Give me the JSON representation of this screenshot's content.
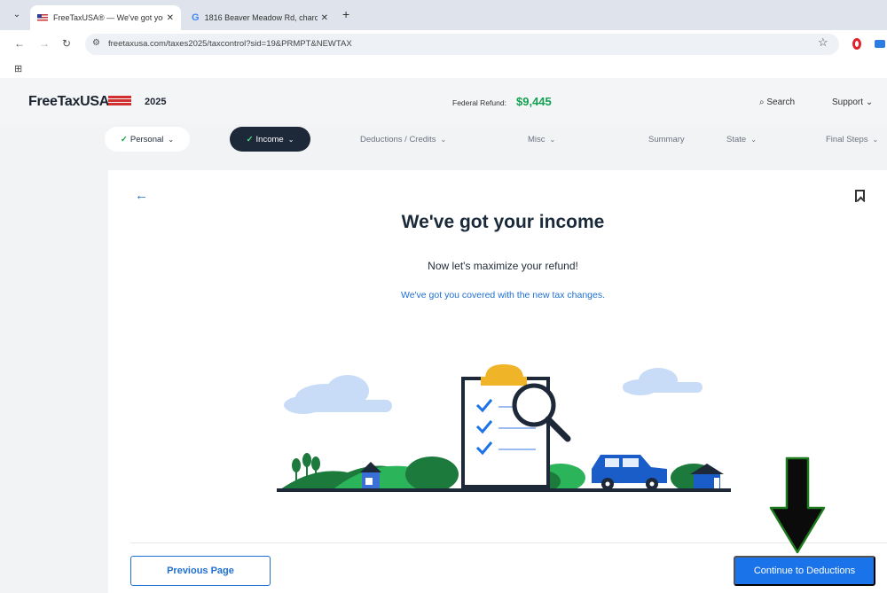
{
  "browser": {
    "tabs": [
      {
        "title": "FreeTaxUSA® — We've got you",
        "active": true
      },
      {
        "title": "1816 Beaver Meadow Rd, charc",
        "active": false
      }
    ],
    "url": "freetaxusa.com/taxes2025/taxcontrol?sid=19&PRMPT&NEWTAX"
  },
  "header": {
    "logo": "FreeTaxUSA",
    "year": "2025",
    "refund_label": "Federal Refund:",
    "refund_value": "$9,445",
    "search_label": "Search",
    "support_label": "Support"
  },
  "steps": [
    {
      "label": "Personal",
      "status": "done"
    },
    {
      "label": "Income",
      "status": "current"
    },
    {
      "label": "Deductions / Credits",
      "status": "todo"
    },
    {
      "label": "Misc",
      "status": "todo"
    },
    {
      "label": "Summary",
      "status": "todo"
    },
    {
      "label": "State",
      "status": "todo"
    },
    {
      "label": "Final Steps",
      "status": "todo"
    }
  ],
  "main": {
    "title": "We've got your income",
    "subtitle": "Now let's maximize your refund!",
    "link_text": "We've got you covered with the new tax changes.",
    "prev_button": "Previous Page",
    "next_button": "Continue to Deductions"
  },
  "colors": {
    "accent": "#1a73e8",
    "refund_green": "#12a150",
    "nav_dark": "#1d2839"
  }
}
